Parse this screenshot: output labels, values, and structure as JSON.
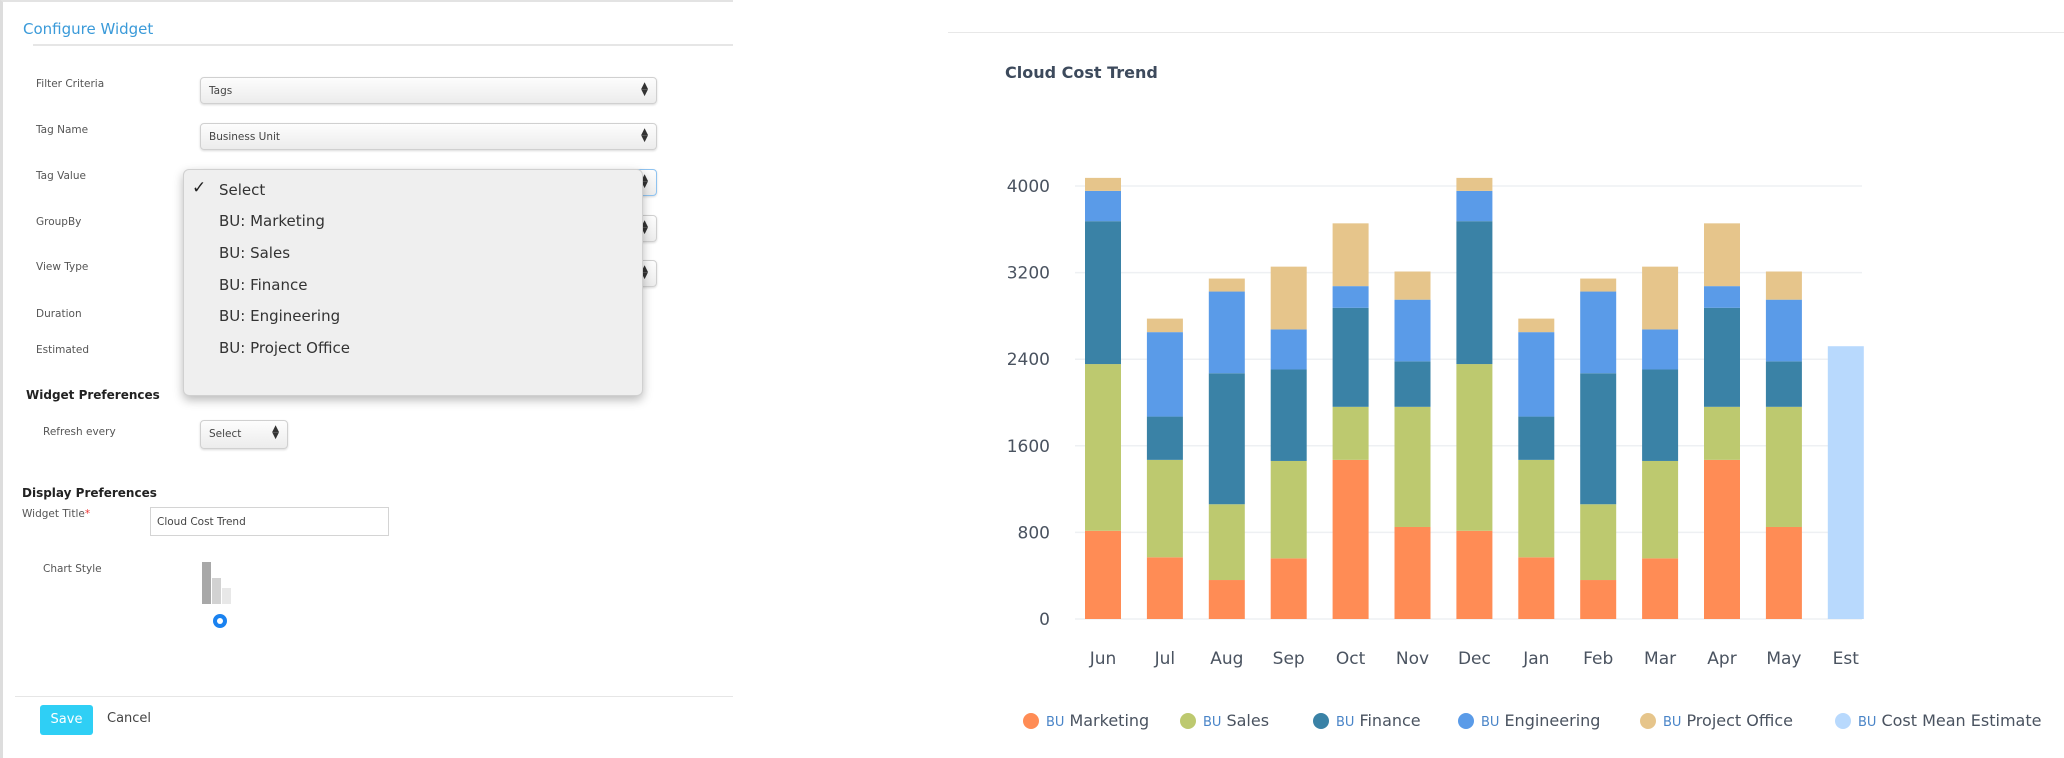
{
  "config": {
    "title": "Configure Widget",
    "fields": [
      {
        "label": "Filter Criteria",
        "value": "Tags"
      },
      {
        "label": "Tag Name",
        "value": "Business Unit"
      },
      {
        "label": "Tag Value",
        "value": ""
      },
      {
        "label": "GroupBy",
        "value": ""
      },
      {
        "label": "View Type",
        "value": ""
      },
      {
        "label": "Duration"
      },
      {
        "label": "Estimated"
      }
    ],
    "dropdown": {
      "selected": "Select",
      "options": [
        "Select",
        "BU: Marketing",
        "BU: Sales",
        "BU: Finance",
        "BU: Engineering",
        "BU: Project Office"
      ]
    },
    "widget_prefs": {
      "heading": "Widget Preferences",
      "refresh_label": "Refresh every",
      "refresh_value": "Select"
    },
    "display_prefs": {
      "heading": "Display Preferences",
      "title_label": "Widget Title",
      "required_mark": "*",
      "title_value": "Cloud Cost Trend",
      "chart_style_label": "Chart Style"
    },
    "save_label": "Save",
    "cancel_label": "Cancel",
    "accent_color": "#2fcff5"
  },
  "chart_data": {
    "type": "bar",
    "stacked": true,
    "title": "Cloud Cost Trend",
    "categories": [
      "Jun",
      "Jul",
      "Aug",
      "Sep",
      "Oct",
      "Nov",
      "Dec",
      "Jan",
      "Feb",
      "Mar",
      "Apr",
      "May",
      "Est"
    ],
    "ylim": [
      0,
      4000
    ],
    "yticks": [
      "0",
      "800",
      "1600",
      "2400",
      "3200",
      "4000"
    ],
    "grid": true,
    "legend_position": "bottom",
    "legend_prefix": "BU",
    "series": [
      {
        "name": "Marketing",
        "color": "#ff8c55",
        "values": [
          815,
          570,
          360,
          560,
          1470,
          850,
          815,
          570,
          360,
          560,
          1470,
          850,
          null
        ]
      },
      {
        "name": "Sales",
        "color": "#bdc96f",
        "values": [
          1540,
          900,
          700,
          900,
          490,
          1110,
          1540,
          900,
          700,
          900,
          490,
          1110,
          null
        ]
      },
      {
        "name": "Finance",
        "color": "#3a82a6",
        "values": [
          1320,
          400,
          1210,
          845,
          915,
          420,
          1320,
          400,
          1210,
          845,
          915,
          420,
          null
        ]
      },
      {
        "name": "Engineering",
        "color": "#5a9be8",
        "values": [
          280,
          780,
          755,
          370,
          200,
          570,
          280,
          780,
          755,
          370,
          200,
          570,
          null
        ]
      },
      {
        "name": "Project Office",
        "color": "#e6c58b",
        "values": [
          120,
          125,
          120,
          580,
          580,
          260,
          120,
          125,
          120,
          580,
          580,
          260,
          null
        ]
      },
      {
        "name": "Cost Mean Estimate",
        "color": "#b8d9fd",
        "values": [
          null,
          null,
          null,
          null,
          null,
          null,
          null,
          null,
          null,
          null,
          null,
          null,
          2520
        ]
      }
    ]
  }
}
